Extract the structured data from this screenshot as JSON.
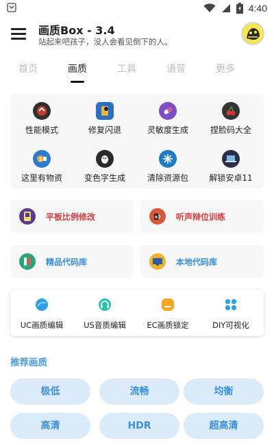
{
  "status_bar": {
    "time": "4:40"
  },
  "header": {
    "title": "画质Box - 3.4",
    "subtitle": "站起来吧孩子，没人会看见倒下的人。"
  },
  "tabs": [
    {
      "label": "首页",
      "active": false
    },
    {
      "label": "画质",
      "active": true
    },
    {
      "label": "工具",
      "active": false
    },
    {
      "label": "语音",
      "active": false
    },
    {
      "label": "更多",
      "active": false
    }
  ],
  "grid": [
    {
      "label": "性能模式",
      "icon": "performance-icon",
      "color": "#c63a2c"
    },
    {
      "label": "修复闪退",
      "icon": "repair-icon",
      "color": "#f2b43a"
    },
    {
      "label": "灵敏度生成",
      "icon": "pill-icon",
      "color": "#7c4fc4"
    },
    {
      "label": "捏脸码大全",
      "icon": "cherry-icon",
      "color": "#333333"
    },
    {
      "label": "这里有物资",
      "icon": "supplies-icon",
      "color": "#2d7bd0"
    },
    {
      "label": "变色字生成",
      "icon": "penguin-icon",
      "color": "#2a2a2a"
    },
    {
      "label": "清除资源包",
      "icon": "snowflake-icon",
      "color": "#1f7dc2"
    },
    {
      "label": "解锁安卓11",
      "icon": "laptop-icon",
      "color": "#2b2f46"
    }
  ],
  "feature_cards": [
    {
      "label": "平板比例修改",
      "icon": "tablet-icon",
      "icon_color": "#5a3a8c",
      "text_color": "#d83b3b"
    },
    {
      "label": "听声辩位训练",
      "icon": "speaker-icon",
      "icon_color": "#d65a3a",
      "text_color": "#d83b3b"
    },
    {
      "label": "精品代码库",
      "icon": "code-box-icon",
      "icon_color": "#2ba37a",
      "text_color": "#3a8fdc"
    },
    {
      "label": "本地代码库",
      "icon": "monitor-icon",
      "icon_color": "#f0b22e",
      "text_color": "#3a8fdc"
    }
  ],
  "editors": [
    {
      "label": "UC画质编辑",
      "icon": "uc-edit-icon",
      "color": "#2fa0e8"
    },
    {
      "label": "US音质编辑",
      "icon": "headphone-icon",
      "color": "#26c2b0"
    },
    {
      "label": "EC画质锁定",
      "icon": "lock-box-icon",
      "color": "#f5a623"
    },
    {
      "label": "DIY可视化",
      "icon": "diy-icon",
      "color": "#2fa0e8"
    }
  ],
  "recommend": {
    "title": "推荐画质",
    "options": [
      "极低",
      "流畅",
      "均衡",
      "高清",
      "HDR",
      "超高清"
    ]
  },
  "colors": {
    "accent": "#3a8fdc",
    "pill_bg": "#dcebfa",
    "card_bg": "#f7f7f7"
  }
}
